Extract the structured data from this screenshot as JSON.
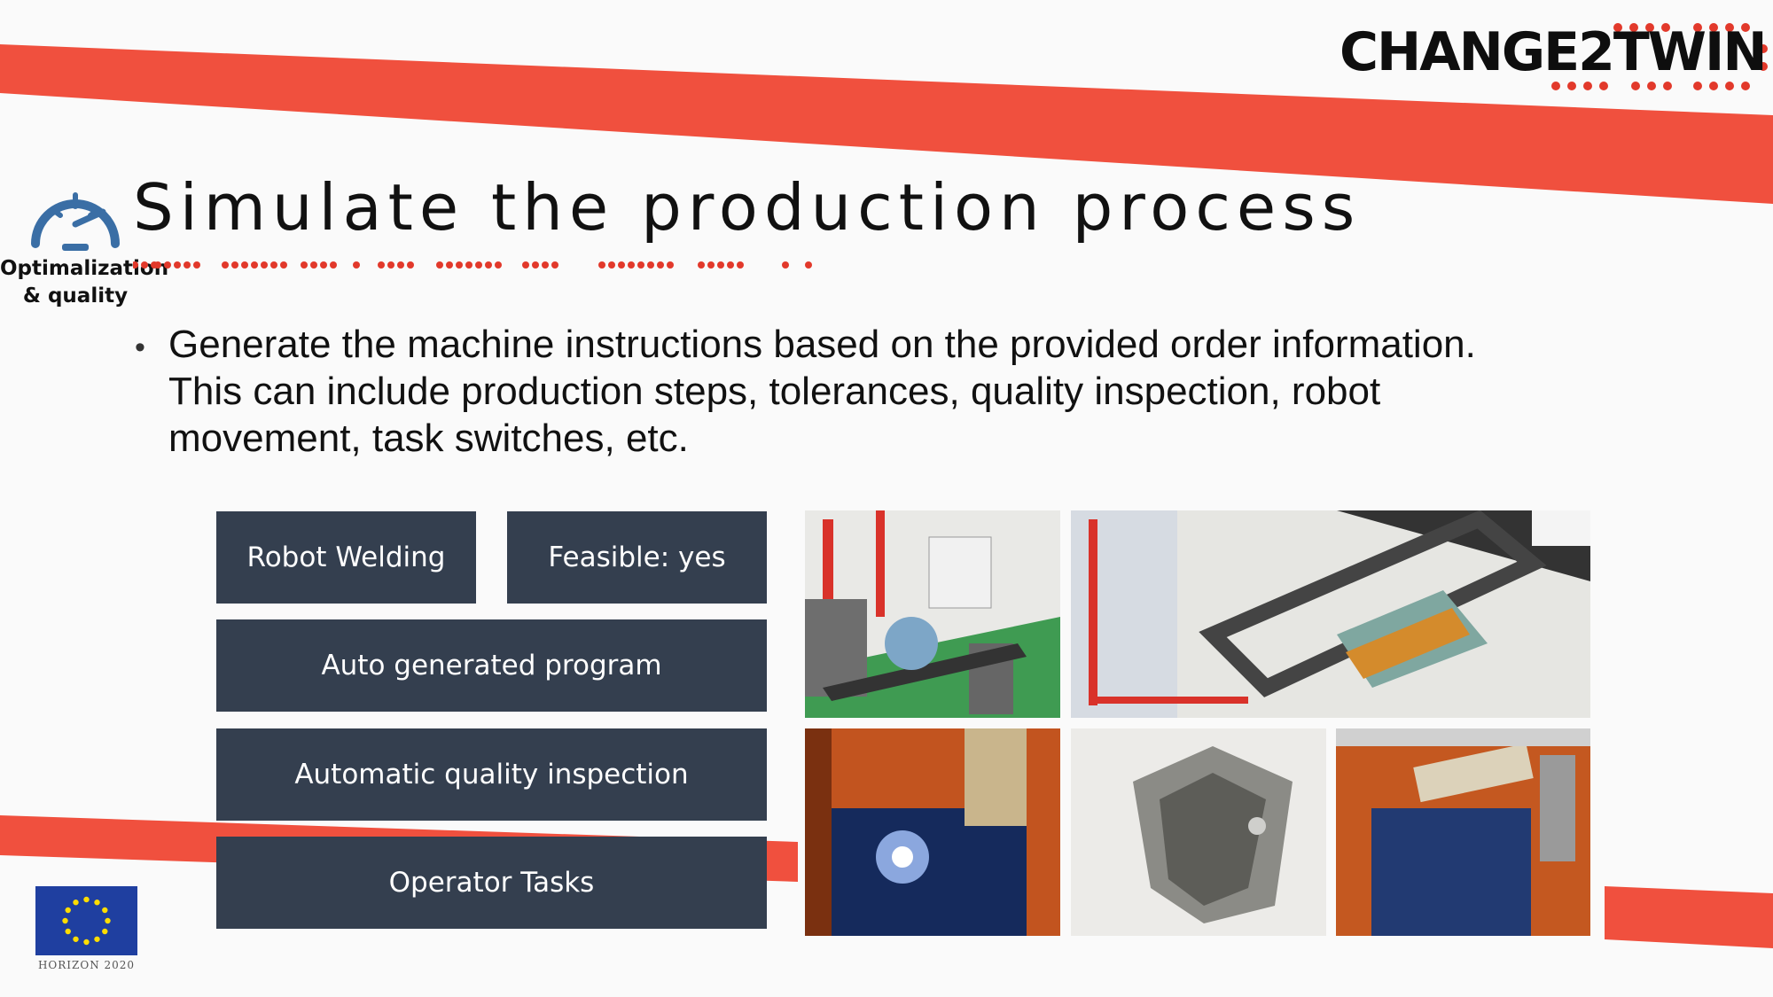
{
  "logo": {
    "text": "CHANGE2TWIN"
  },
  "badge": {
    "icon": "speedometer-icon",
    "label": "Optimalization & quality"
  },
  "title": "Simulate the production process",
  "bullet": "Generate the machine instructions based on the provided order information. This can include production steps, tolerances, quality inspection, robot movement, task switches, etc.",
  "boxes": {
    "robot_welding": "Robot Welding",
    "feasible": "Feasible: yes",
    "auto_program": "Auto generated program",
    "quality_inspection": "Automatic quality inspection",
    "operator_tasks": "Operator Tasks"
  },
  "photos": [
    "robot-cell-simulation-image",
    "welding-fixture-simulation-image",
    "welding-arc-photo",
    "welded-part-photo",
    "welding-robot-photo"
  ],
  "footer": {
    "programme": "HORIZON 2020"
  },
  "colors": {
    "ribbon": "#f0503e",
    "box": "#343f4f",
    "eu_blue": "#1f3fa0",
    "gauge": "#3a6ea5"
  }
}
